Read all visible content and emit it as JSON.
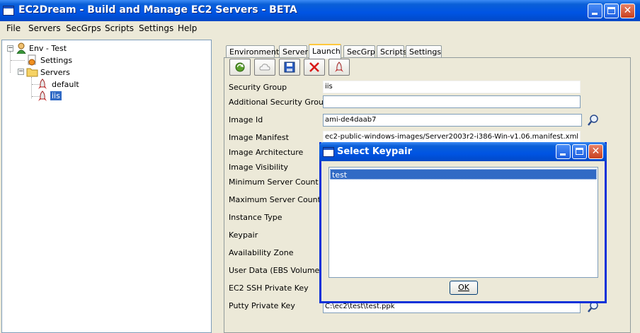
{
  "window": {
    "title": "EC2Dream - Build and Manage EC2 Servers - BETA",
    "controls": {
      "minimize": "_",
      "maximize": "□",
      "close": "✕"
    }
  },
  "menubar": {
    "items": [
      {
        "label": "File"
      },
      {
        "label": "Servers"
      },
      {
        "label": "SecGrps"
      },
      {
        "label": "Scripts"
      },
      {
        "label": "Settings"
      },
      {
        "label": "Help"
      }
    ]
  },
  "tree": {
    "root": {
      "label": "Env - Test",
      "expander": "−"
    },
    "settings": {
      "label": "Settings"
    },
    "servers": {
      "label": "Servers",
      "expander": "−"
    },
    "children": [
      {
        "label": "default"
      },
      {
        "label": "iis"
      }
    ]
  },
  "tabs": [
    {
      "label": "Environment"
    },
    {
      "label": "Server"
    },
    {
      "label": "Launch"
    },
    {
      "label": "SecGrp"
    },
    {
      "label": "Scripts"
    },
    {
      "label": "Settings"
    }
  ],
  "toolbar": {
    "icons": [
      "refresh-icon",
      "cloud-icon",
      "save-icon",
      "delete-icon",
      "launch-icon"
    ]
  },
  "form": {
    "labels": {
      "security_group": "Security Group",
      "additional_security_groups": "Additional Security Groups",
      "image_id": "Image Id",
      "image_manifest": "Image Manifest",
      "image_architecture": "Image Architecture",
      "image_visibility": "Image Visibility",
      "min_server_count": "Minimum Server Count",
      "max_server_count": "Maximum Server Count",
      "instance_type": "Instance Type",
      "keypair": "Keypair",
      "availability_zone": "Availability Zone",
      "user_data": "User Data (EBS Volume)",
      "ec2_ssh_key": "EC2 SSH Private Key",
      "putty_key": "Putty Private Key"
    },
    "values": {
      "security_group": "iis",
      "additional_security_groups": "",
      "image_id": "ami-de4daab7",
      "image_manifest": "ec2-public-windows-images/Server2003r2-i386-Win-v1.06.manifest.xml",
      "putty_key": "C:\\ec2\\test\\test.ppk"
    }
  },
  "dialog": {
    "title": "Select Keypair",
    "items": [
      "test"
    ],
    "ok_label": "OK"
  },
  "colors": {
    "title_blue": "#0054e3",
    "selection": "#316ac5",
    "face": "#ece9d8"
  }
}
